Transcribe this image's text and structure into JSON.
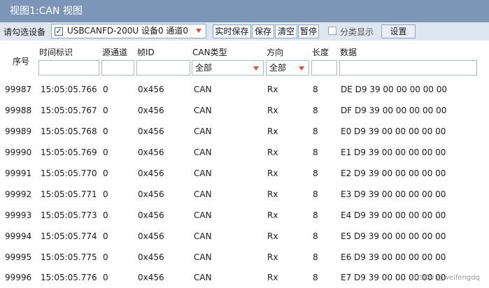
{
  "window": {
    "title": "视图1:CAN 视图"
  },
  "toolbar": {
    "device_label": "请勾选设备",
    "device_checked": "✓",
    "device_value": "USBCANFD-200U 设备0 通道0",
    "btn_realtime_save": "实时保存",
    "btn_save": "保存",
    "btn_clear": "清空",
    "btn_pause": "暂停",
    "group_display_label": "分类显示",
    "btn_settings": "设置"
  },
  "columns": {
    "seq": "序号",
    "time": "时间标识",
    "src": "源通道",
    "id": "帧ID",
    "type": "CAN类型",
    "dir": "方向",
    "len": "长度",
    "data": "数据"
  },
  "filters": {
    "type_value": "全部",
    "dir_value": "全部"
  },
  "rows": [
    {
      "seq": "99987",
      "time": "15:05:05.766",
      "src": "0",
      "id": "0x456",
      "type": "CAN",
      "dir": "Rx",
      "len": "8",
      "data": "DE D9 39 00 00 00 00 00"
    },
    {
      "seq": "99988",
      "time": "15:05:05.767",
      "src": "0",
      "id": "0x456",
      "type": "CAN",
      "dir": "Rx",
      "len": "8",
      "data": "DF D9 39 00 00 00 00 00"
    },
    {
      "seq": "99989",
      "time": "15:05:05.768",
      "src": "0",
      "id": "0x456",
      "type": "CAN",
      "dir": "Rx",
      "len": "8",
      "data": "E0 D9 39 00 00 00 00 00"
    },
    {
      "seq": "99990",
      "time": "15:05:05.769",
      "src": "0",
      "id": "0x456",
      "type": "CAN",
      "dir": "Rx",
      "len": "8",
      "data": "E1 D9 39 00 00 00 00 00"
    },
    {
      "seq": "99991",
      "time": "15:05:05.770",
      "src": "0",
      "id": "0x456",
      "type": "CAN",
      "dir": "Rx",
      "len": "8",
      "data": "E2 D9 39 00 00 00 00 00"
    },
    {
      "seq": "99992",
      "time": "15:05:05.771",
      "src": "0",
      "id": "0x456",
      "type": "CAN",
      "dir": "Rx",
      "len": "8",
      "data": "E3 D9 39 00 00 00 00 00"
    },
    {
      "seq": "99993",
      "time": "15:05:05.773",
      "src": "0",
      "id": "0x456",
      "type": "CAN",
      "dir": "Rx",
      "len": "8",
      "data": "E4 D9 39 00 00 00 00 00"
    },
    {
      "seq": "99994",
      "time": "15:05:05.774",
      "src": "0",
      "id": "0x456",
      "type": "CAN",
      "dir": "Rx",
      "len": "8",
      "data": "E5 D9 39 00 00 00 00 00"
    },
    {
      "seq": "99995",
      "time": "15:05:05.775",
      "src": "0",
      "id": "0x456",
      "type": "CAN",
      "dir": "Rx",
      "len": "8",
      "data": "E6 D9 39 00 00 00 00 00"
    },
    {
      "seq": "99996",
      "time": "15:05:05.776",
      "src": "0",
      "id": "0x456",
      "type": "CAN",
      "dir": "Rx",
      "len": "8",
      "data": "E7 D9 39 00 00 00 00 00"
    }
  ],
  "watermark": "CSDN @weifengdq",
  "icons": {
    "dropdown": "dropdown-arrow-icon",
    "check": "checkbox-check-icon"
  },
  "colors": {
    "title_bar": "#7d96b8",
    "toolbar": "#dde6f1",
    "dropdown_arrow": "#e24b3b"
  }
}
